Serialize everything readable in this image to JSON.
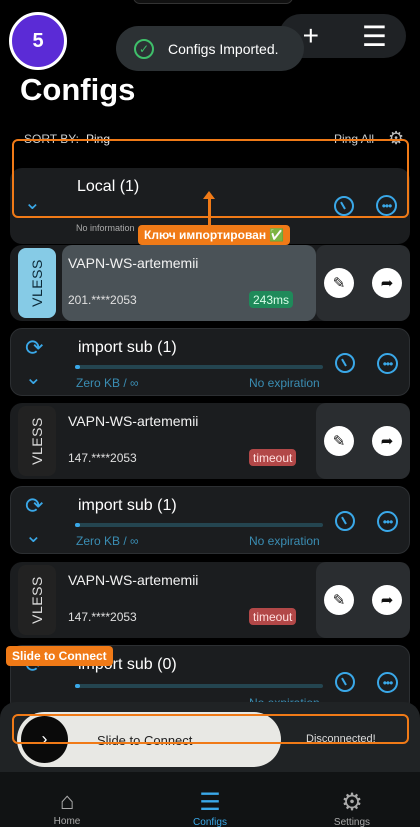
{
  "step_badge": "5",
  "toast": {
    "message": "Configs Imported.",
    "icon": "check-circle-icon"
  },
  "header": {
    "title": "Configs",
    "add_icon": "+",
    "list_icon": "☰"
  },
  "sort": {
    "label": "SORT BY:",
    "value": "Ping",
    "ping_all": "Ping All",
    "gear_icon": "⚙"
  },
  "groups": [
    {
      "name": "Local (1)",
      "info": "No information"
    },
    {
      "name": "import sub (1)",
      "usage": "Zero KB / ∞",
      "expiration": "No expiration"
    },
    {
      "name": "import sub (1)",
      "usage": "Zero KB / ∞",
      "expiration": "No expiration"
    },
    {
      "name": "import sub (0)",
      "usage": "Zero KB / ∞",
      "expiration": "No expiration"
    }
  ],
  "servers": [
    {
      "protocol": "VLESS",
      "name": "VAPN-WS-artememii",
      "address": "201.****2053",
      "latency": "243ms",
      "status": "ok"
    },
    {
      "protocol": "VLESS",
      "name": "VAPN-WS-artememii",
      "address": "147.****2053",
      "latency": "timeout",
      "status": "timeout"
    },
    {
      "protocol": "VLESS",
      "name": "VAPN-WS-artememii",
      "address": "147.****2053",
      "latency": "timeout",
      "status": "timeout"
    }
  ],
  "annotations": {
    "imported_key": "Ключ импортирован ✅",
    "slide_to_connect": "Slide to Connect"
  },
  "slider": {
    "label": "Slide to Connect",
    "state": "Disconnected!"
  },
  "tabs": [
    {
      "label": "Home",
      "icon": "home-icon"
    },
    {
      "label": "Configs",
      "icon": "list-icon"
    },
    {
      "label": "Settings",
      "icon": "gear-icon"
    }
  ],
  "colors": {
    "accent": "#3aa8e8",
    "annotation": "#f07a17",
    "badge": "#5b2bd6",
    "ok": "#1f8a5a",
    "timeout": "#b24848"
  }
}
